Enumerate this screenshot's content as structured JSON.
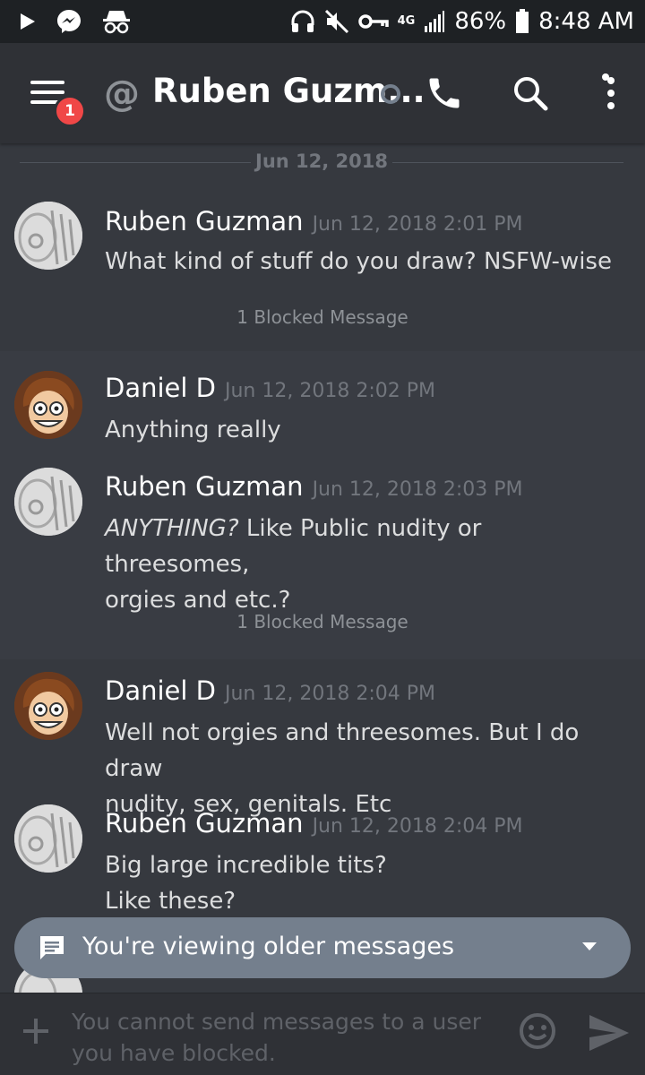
{
  "status_bar": {
    "battery_percent": "86%",
    "time": "8:48 AM",
    "network": "4G",
    "icons": [
      "play-icon",
      "messenger-icon",
      "incognito-icon",
      "headphones-icon",
      "mute-icon",
      "key-icon",
      "signal-icon",
      "battery-icon"
    ]
  },
  "header": {
    "title": "Ruben Guzm...",
    "badge_count": "1",
    "icons": [
      "menu-icon",
      "at-icon",
      "phone-icon",
      "search-icon",
      "more-vertical-icon"
    ]
  },
  "date_divider": "Jun 12, 2018",
  "messages": [
    {
      "author": "Ruben Guzman",
      "timestamp": "Jun 12, 2018 2:01 PM",
      "lines": [
        "What kind of stuff do you draw? NSFW-wise"
      ],
      "blocked": "1 Blocked Message"
    },
    {
      "author": "Daniel D",
      "timestamp": "Jun 12, 2018 2:02 PM",
      "lines": [
        "Anything really"
      ]
    },
    {
      "author": "Ruben Guzman",
      "timestamp": "Jun 12, 2018 2:03 PM",
      "emphasis": "ANYTHING?",
      "lines": [
        " Like Public nudity or threesomes,",
        "orgies and etc.?"
      ],
      "blocked": "1 Blocked Message"
    },
    {
      "author": "Daniel D",
      "timestamp": "Jun 12, 2018 2:04 PM",
      "lines": [
        "Well not orgies and threesomes. But I do draw",
        "nudity, sex, genitals. Etc"
      ]
    },
    {
      "author": "Ruben Guzman",
      "timestamp": "Jun 12, 2018 2:04 PM",
      "lines": [
        "Big large incredible tits?",
        "Like these?"
      ]
    }
  ],
  "older_banner": "You're viewing older messages",
  "composer": {
    "placeholder": "You cannot send messages to a user you have blocked."
  },
  "colors": {
    "background": "#36393f",
    "header": "#2f3136",
    "statusbar": "#1e2124",
    "badge": "#f04747",
    "banner": "#747f8d"
  }
}
